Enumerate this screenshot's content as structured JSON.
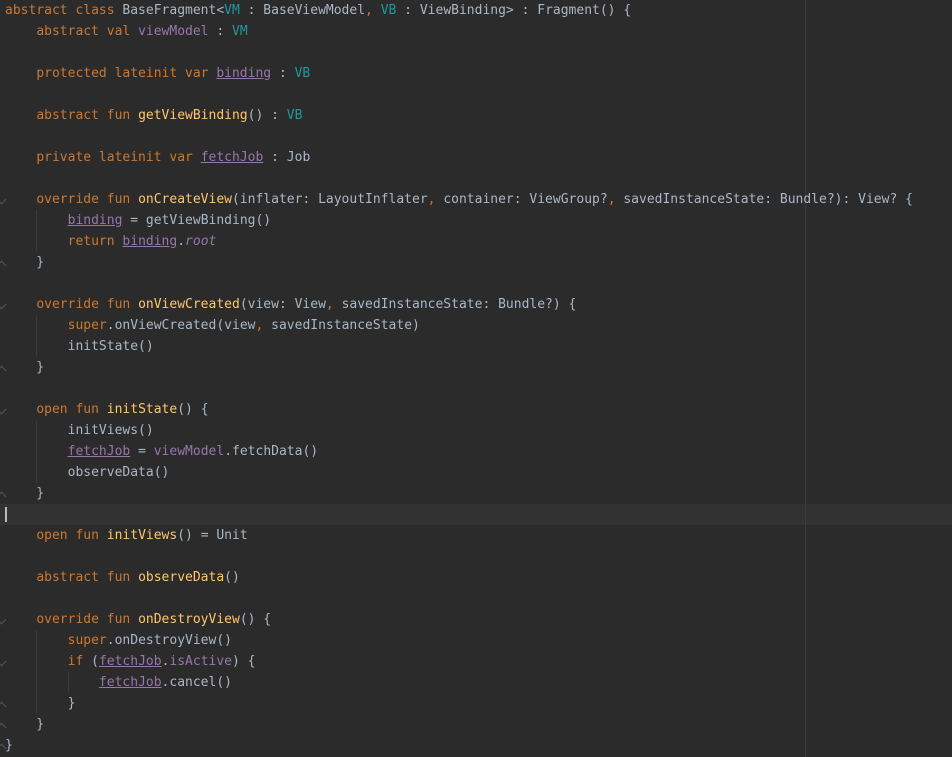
{
  "editor": {
    "language": "Kotlin",
    "lines": [
      [
        [
          "kw",
          "abstract class "
        ],
        [
          "plain",
          "BaseFragment<"
        ],
        [
          "tp",
          "VM"
        ],
        [
          "plain",
          " : BaseViewModel"
        ],
        [
          "kw",
          ", "
        ],
        [
          "tp",
          "VB"
        ],
        [
          "plain",
          " : ViewBinding> : Fragment() {"
        ]
      ],
      [
        [
          "plain",
          "    "
        ],
        [
          "kw",
          "abstract val "
        ],
        [
          "prop",
          "viewModel"
        ],
        [
          "plain",
          " : "
        ],
        [
          "tp",
          "VM"
        ]
      ],
      [],
      [
        [
          "plain",
          "    "
        ],
        [
          "kw",
          "protected lateinit var "
        ],
        [
          "prop-u",
          "binding"
        ],
        [
          "plain",
          " : "
        ],
        [
          "tp",
          "VB"
        ]
      ],
      [],
      [
        [
          "plain",
          "    "
        ],
        [
          "kw",
          "abstract fun "
        ],
        [
          "fn",
          "getViewBinding"
        ],
        [
          "plain",
          "() : "
        ],
        [
          "tp",
          "VB"
        ]
      ],
      [],
      [
        [
          "plain",
          "    "
        ],
        [
          "kw",
          "private lateinit var "
        ],
        [
          "prop-u",
          "fetchJob"
        ],
        [
          "plain",
          " : Job"
        ]
      ],
      [],
      [
        [
          "plain",
          "    "
        ],
        [
          "kw",
          "override fun "
        ],
        [
          "fn",
          "onCreateView"
        ],
        [
          "plain",
          "(inflater: LayoutInflater"
        ],
        [
          "kw",
          ", "
        ],
        [
          "plain",
          "container: ViewGroup?"
        ],
        [
          "kw",
          ", "
        ],
        [
          "plain",
          "savedInstanceState: Bundle?): View? {"
        ]
      ],
      [
        [
          "plain",
          "        "
        ],
        [
          "prop-u",
          "binding"
        ],
        [
          "plain",
          " = getViewBinding()"
        ]
      ],
      [
        [
          "plain",
          "        "
        ],
        [
          "kw",
          "return "
        ],
        [
          "prop-u",
          "binding"
        ],
        [
          "plain",
          "."
        ],
        [
          "it",
          "root"
        ]
      ],
      [
        [
          "plain",
          "    }"
        ]
      ],
      [],
      [
        [
          "plain",
          "    "
        ],
        [
          "kw",
          "override fun "
        ],
        [
          "fn",
          "onViewCreated"
        ],
        [
          "plain",
          "(view: View"
        ],
        [
          "kw",
          ", "
        ],
        [
          "plain",
          "savedInstanceState: Bundle?) {"
        ]
      ],
      [
        [
          "plain",
          "        "
        ],
        [
          "kw",
          "super"
        ],
        [
          "plain",
          ".onViewCreated(view"
        ],
        [
          "kw",
          ", "
        ],
        [
          "plain",
          "savedInstanceState)"
        ]
      ],
      [
        [
          "plain",
          "        initState()"
        ]
      ],
      [
        [
          "plain",
          "    }"
        ]
      ],
      [],
      [
        [
          "plain",
          "    "
        ],
        [
          "kw",
          "open fun "
        ],
        [
          "fn",
          "initState"
        ],
        [
          "plain",
          "() {"
        ]
      ],
      [
        [
          "plain",
          "        initViews()"
        ]
      ],
      [
        [
          "plain",
          "        "
        ],
        [
          "prop-u",
          "fetchJob"
        ],
        [
          "plain",
          " = "
        ],
        [
          "prop",
          "viewModel"
        ],
        [
          "plain",
          ".fetchData()"
        ]
      ],
      [
        [
          "plain",
          "        observeData()"
        ]
      ],
      [
        [
          "plain",
          "    }"
        ]
      ],
      [],
      [
        [
          "plain",
          "    "
        ],
        [
          "kw",
          "open fun "
        ],
        [
          "fn",
          "initViews"
        ],
        [
          "plain",
          "() = Unit"
        ]
      ],
      [],
      [
        [
          "plain",
          "    "
        ],
        [
          "kw",
          "abstract fun "
        ],
        [
          "fn",
          "observeData"
        ],
        [
          "plain",
          "()"
        ]
      ],
      [],
      [
        [
          "plain",
          "    "
        ],
        [
          "kw",
          "override fun "
        ],
        [
          "fn",
          "onDestroyView"
        ],
        [
          "plain",
          "() {"
        ]
      ],
      [
        [
          "plain",
          "        "
        ],
        [
          "kw",
          "super"
        ],
        [
          "plain",
          ".onDestroyView()"
        ]
      ],
      [
        [
          "plain",
          "        "
        ],
        [
          "kw",
          "if "
        ],
        [
          "plain",
          "("
        ],
        [
          "prop-u",
          "fetchJob"
        ],
        [
          "plain",
          "."
        ],
        [
          "prop",
          "isActive"
        ],
        [
          "plain",
          ") {"
        ]
      ],
      [
        [
          "plain",
          "            "
        ],
        [
          "prop-u",
          "fetchJob"
        ],
        [
          "plain",
          ".cancel()"
        ]
      ],
      [
        [
          "plain",
          "        }"
        ]
      ],
      [
        [
          "plain",
          "    }"
        ]
      ],
      [
        [
          "plain",
          "}"
        ]
      ]
    ],
    "folds": {
      "9": "open",
      "12": "close",
      "14": "open",
      "17": "close",
      "19": "open",
      "23": "close",
      "29": "open",
      "31": "open",
      "33": "close",
      "34": "close",
      "35": "close"
    },
    "colors": {
      "background": "#2b2b2b",
      "keyword": "#cc7832",
      "function": "#ffc66d",
      "type_param": "#20999d",
      "property": "#9876aa",
      "text": "#a9b7c6",
      "current_line": "#323232"
    },
    "icons": {
      "fold_open": "fold-open-icon",
      "fold_close": "fold-close-icon"
    }
  }
}
